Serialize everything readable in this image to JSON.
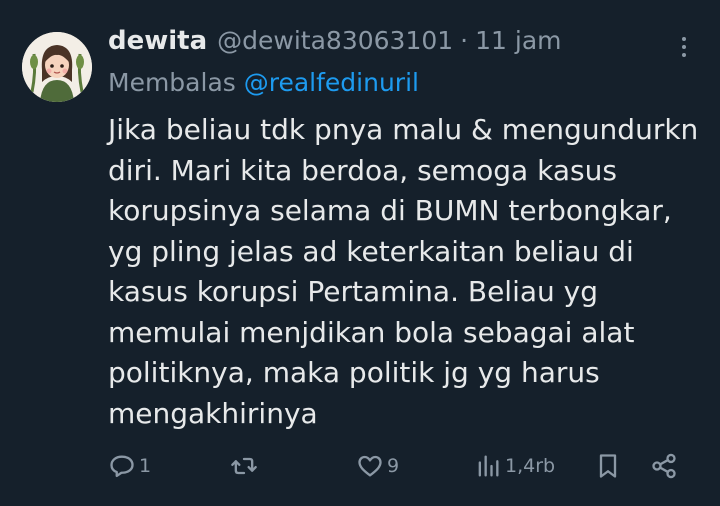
{
  "tweet": {
    "display_name": "dewita",
    "handle": "@dewita83063101",
    "separator": "·",
    "time": "11 jam",
    "reply_prefix": "Membalas",
    "reply_handle": "@realfedinuril",
    "lines": [
      "Jika beliau tdk pnya malu & mengundurkn",
      "diri. Mari kita berdoa, semoga kasus",
      "korupsinya selama di BUMN terbongkar,",
      "yg pling jelas ad keterkaitan beliau di",
      "kasus korupsi Pertamina. Beliau yg",
      "memulai menjdikan bola sebagai alat",
      "politiknya, maka politik jg yg harus",
      "mengakhirinya"
    ]
  },
  "actions": {
    "replies": "1",
    "likes": "9",
    "views": "1,4rb"
  },
  "icons": {
    "reply": "reply-icon",
    "retweet": "retweet-icon",
    "like": "heart-icon",
    "views": "views-icon",
    "bookmark": "bookmark-icon",
    "share": "share-icon",
    "more": "more-icon"
  },
  "colors": {
    "background": "#15202b",
    "text": "#e7e9ea",
    "muted": "#8b98a5",
    "link": "#1d9bf0"
  }
}
